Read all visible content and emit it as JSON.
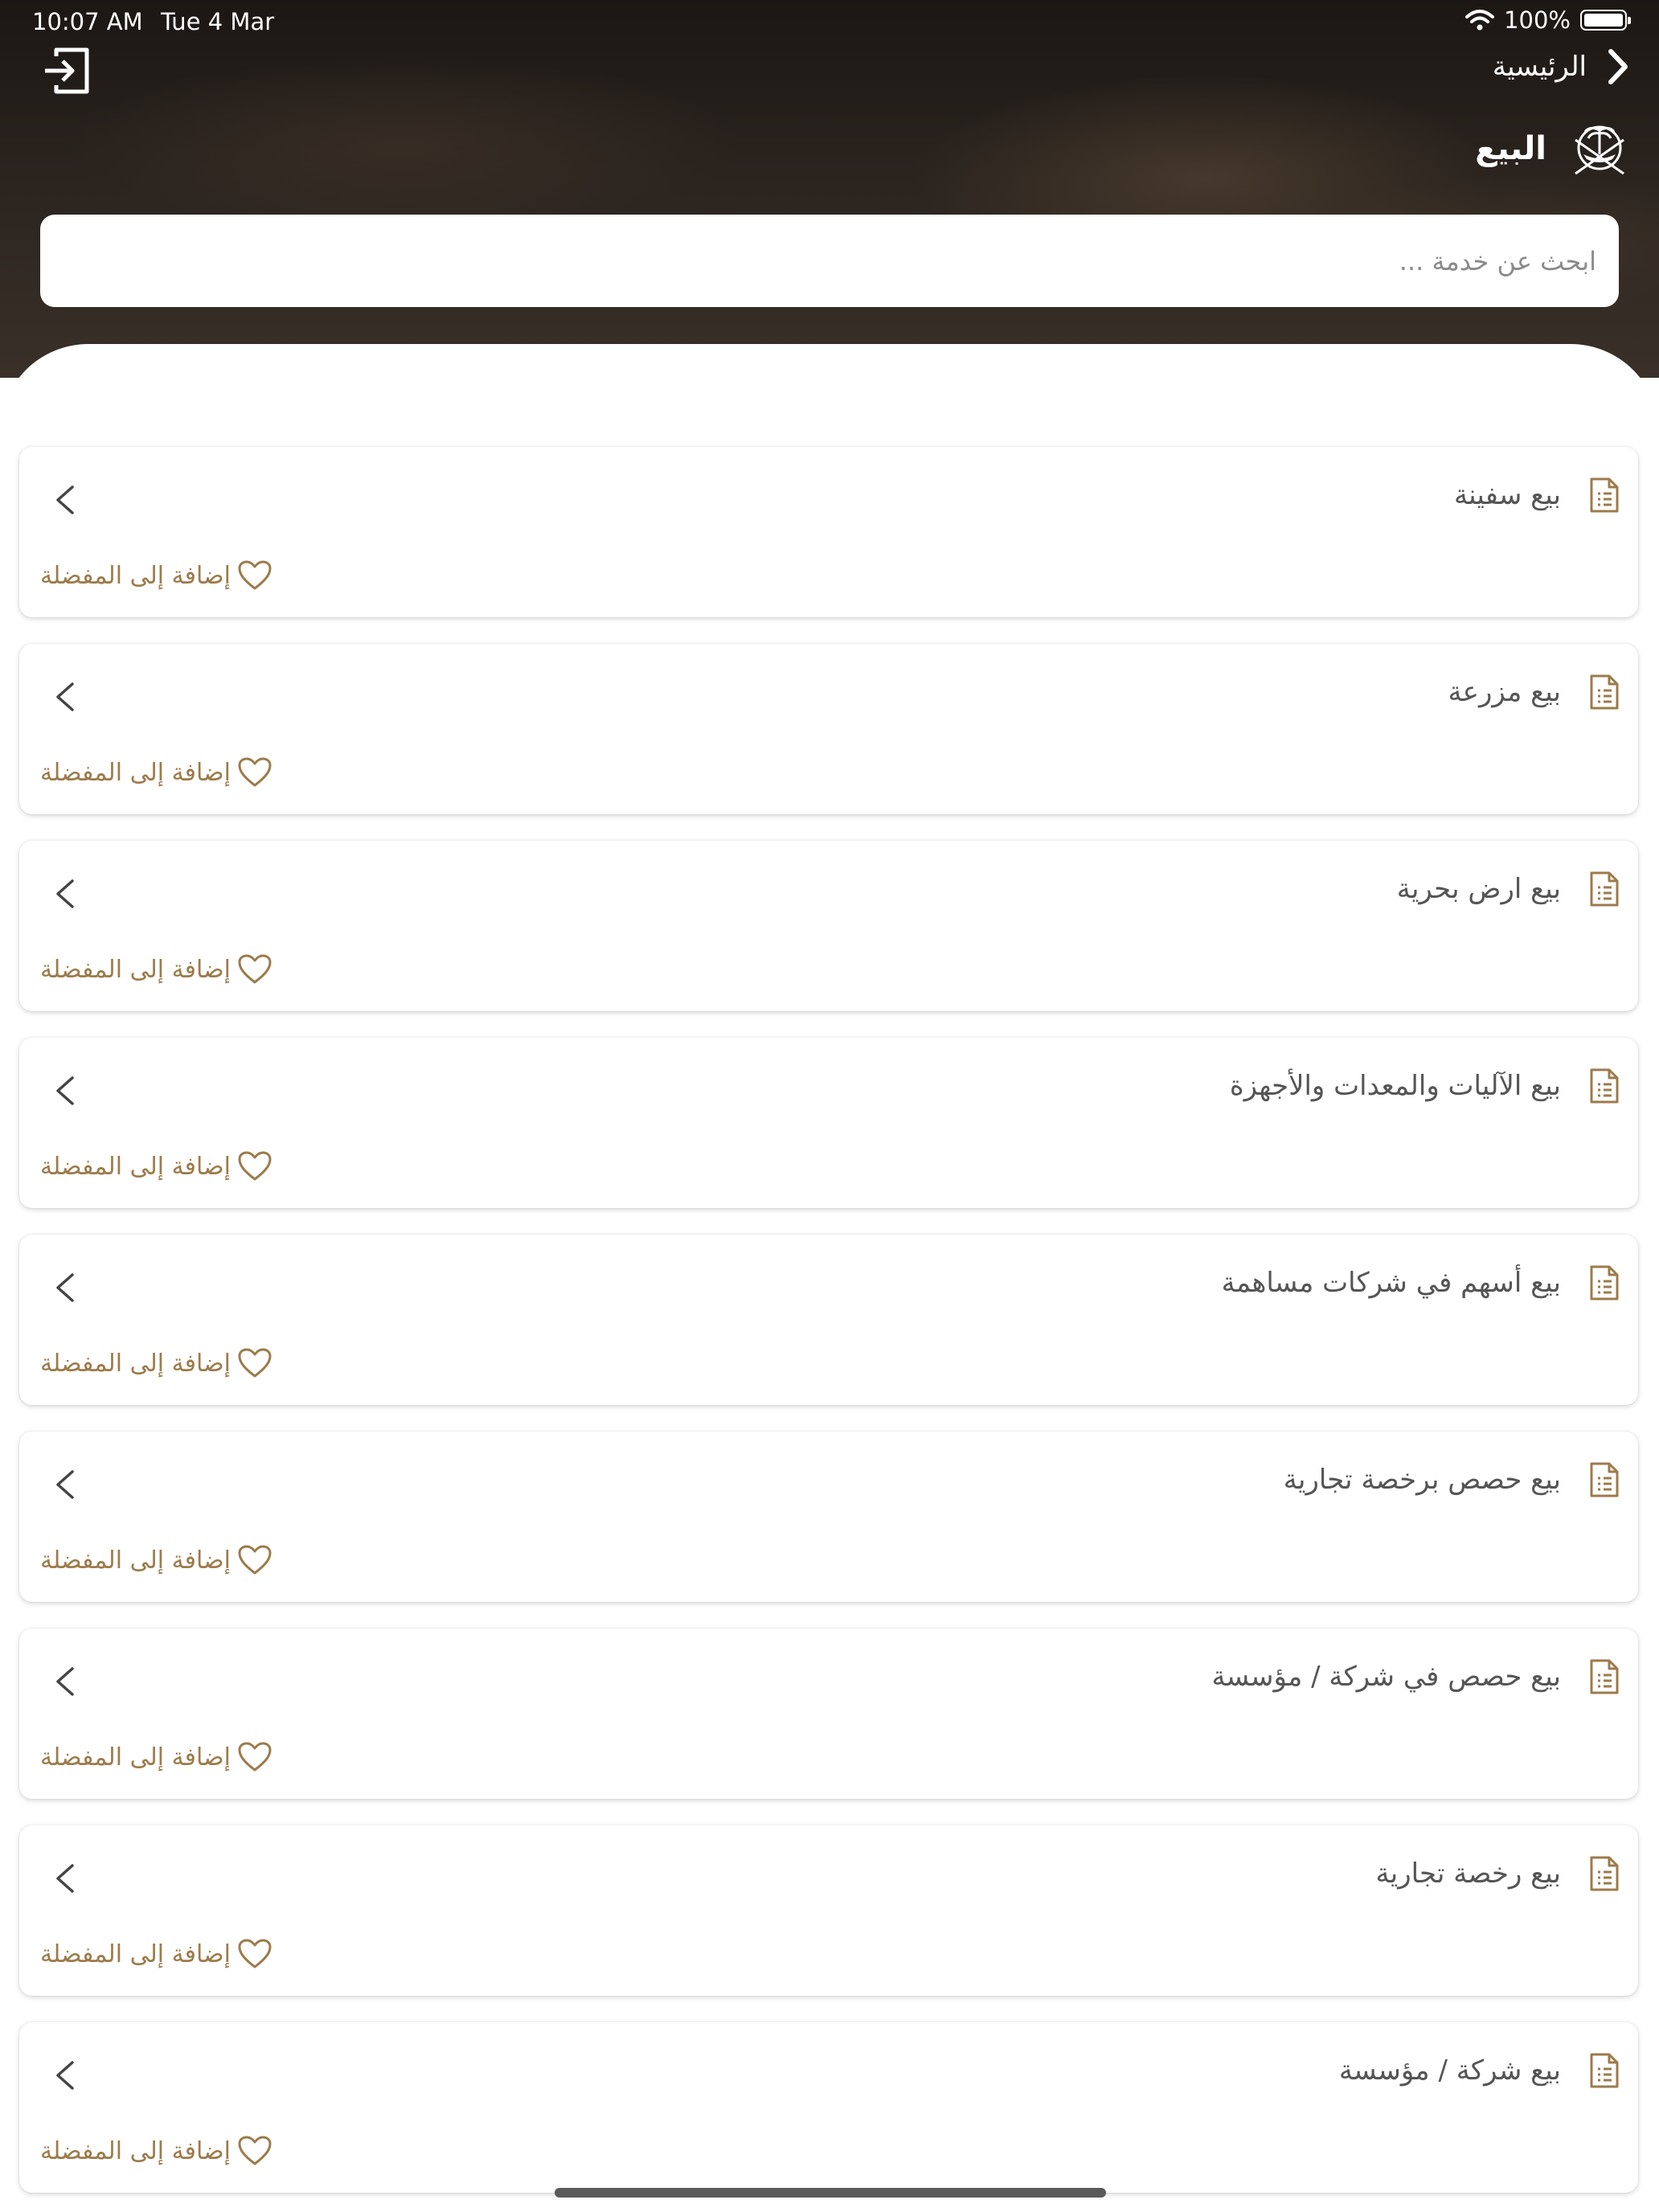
{
  "status_bar": {
    "time": "10:07 AM",
    "date": "Tue 4 Mar",
    "battery": "100%"
  },
  "header": {
    "back_label": "الرئيسية",
    "title": "البيع"
  },
  "search": {
    "placeholder": "ابحث عن خدمة ..."
  },
  "services": [
    {
      "label": "بيع سفينة",
      "fav_label": "إضافة إلى المفضلة"
    },
    {
      "label": "بيع مزرعة",
      "fav_label": "إضافة إلى المفضلة"
    },
    {
      "label": "بيع ارض بحرية",
      "fav_label": "إضافة إلى المفضلة"
    },
    {
      "label": "بيع الآليات والمعدات والأجهزة",
      "fav_label": "إضافة إلى المفضلة"
    },
    {
      "label": "بيع أسهم في شركات مساهمة",
      "fav_label": "إضافة إلى المفضلة"
    },
    {
      "label": "بيع حصص برخصة تجارية",
      "fav_label": "إضافة إلى المفضلة"
    },
    {
      "label": "بيع حصص في شركة / مؤسسة",
      "fav_label": "إضافة إلى المفضلة"
    },
    {
      "label": "بيع رخصة تجارية",
      "fav_label": "إضافة إلى المفضلة"
    },
    {
      "label": "بيع شركة / مؤسسة",
      "fav_label": "إضافة إلى المفضلة"
    }
  ],
  "colors": {
    "accent": "#9c7b4a",
    "title_text": "#555555"
  },
  "icons": {
    "logout": "logout-icon",
    "back": "chevron-right-icon",
    "emblem": "qatar-emblem-icon",
    "document": "document-list-icon",
    "chevron": "chevron-left-icon",
    "heart": "heart-icon"
  }
}
